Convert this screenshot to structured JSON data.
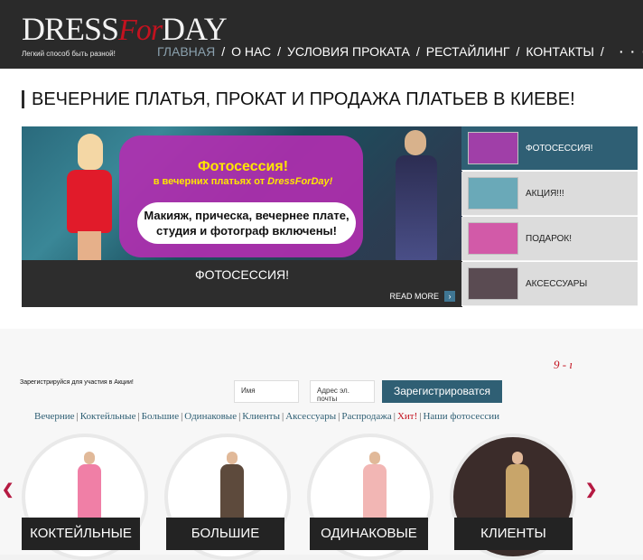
{
  "brand": {
    "logo_left": "DRESS",
    "logo_mid": "For",
    "logo_right": "DAY",
    "tagline": "Легкий способ быть разной!"
  },
  "nav": {
    "items": [
      {
        "label": "ГЛАВНАЯ"
      },
      {
        "label": "О НАС"
      },
      {
        "label": "УСЛОВИЯ ПРОКАТА"
      },
      {
        "label": "РЕСТАЙЛИНГ"
      },
      {
        "label": "КОНТАКТЫ"
      }
    ],
    "separator": "/",
    "extra": "· · · ·"
  },
  "page": {
    "title": "ВЕЧЕРНИЕ ПЛАТЬЯ, ПРОКАТ И ПРОДАЖА ПЛАТЬЕВ В КИЕВЕ!"
  },
  "slider": {
    "headline": "Фотосессия!",
    "sub_prefix": "в вечерних платьях от",
    "sub_brand": "DressForDay!",
    "bubble_line1": "Макияж, прическа, вечернее плате,",
    "bubble_line2": "студия и фотограф включены!",
    "caption": "ФОТОСЕССИЯ!",
    "more": "READ MORE",
    "more_icon": "›"
  },
  "thumbs": [
    {
      "label": "ФОТОСЕССИЯ!",
      "active": true,
      "color": "#a03fa8"
    },
    {
      "label": "АКЦИЯ!!!",
      "active": false,
      "color": "#6aa9b8"
    },
    {
      "label": "ПОДАРОК!",
      "active": false,
      "color": "#d25aa8"
    },
    {
      "label": "АКСЕССУАРЫ",
      "active": false,
      "color": "#5a4b52"
    }
  ],
  "register": {
    "label": "Зарегистрируйся для участия в Акции!",
    "name_placeholder": "Имя",
    "email_placeholder": "Адрес эл. почты",
    "button": "Зарегистрироватся",
    "counter": "9 - ı"
  },
  "categories_links": [
    {
      "label": "Вечерние"
    },
    {
      "label": "Коктейльные"
    },
    {
      "label": "Большие"
    },
    {
      "label": "Одинаковые"
    },
    {
      "label": "Клиенты"
    },
    {
      "label": "Аксессуары"
    },
    {
      "label": "Распродажа"
    },
    {
      "label": "Хит!",
      "hot": true
    },
    {
      "label": "Наши фотосессии"
    }
  ],
  "categories": [
    {
      "label": "КОКТЕЙЛЬНЫЕ",
      "dress_color": "#f07fa6"
    },
    {
      "label": "БОЛЬШИЕ",
      "dress_color": "#5d4a3c"
    },
    {
      "label": "ОДИНАКОВЫЕ",
      "dress_color": "#f2b6b4"
    },
    {
      "label": "КЛИЕНТЫ",
      "dress_color": "#c8a56a"
    }
  ],
  "colors": {
    "accent": "#2f5f74",
    "brand_red": "#c3121f",
    "header_bg": "#2a2a2a"
  },
  "arrows": {
    "left": "❮",
    "right": "❯"
  }
}
